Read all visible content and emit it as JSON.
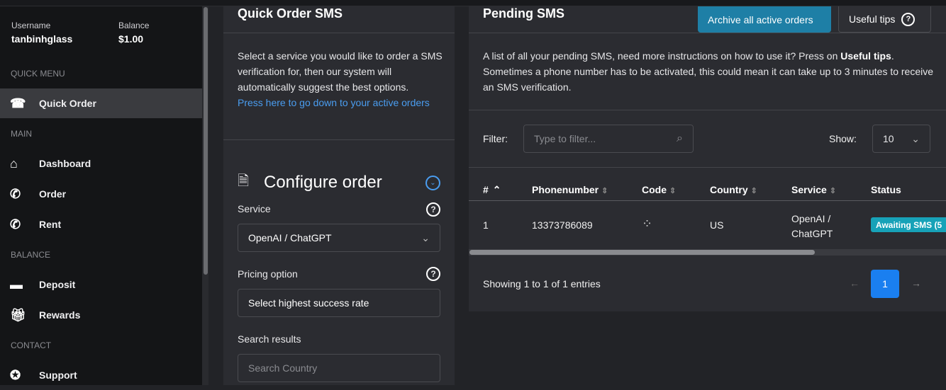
{
  "account": {
    "username_label": "Username",
    "username": "tanbinhglass",
    "balance_label": "Balance",
    "balance": "$1.00"
  },
  "sidebar": {
    "sections": [
      "Quick Menu",
      "Main",
      "Balance",
      "Contact"
    ],
    "items": [
      {
        "label": "Quick Order",
        "icon": "phone-icon"
      },
      {
        "label": "Dashboard",
        "icon": "home-icon"
      },
      {
        "label": "Order",
        "icon": "phone-plus-icon"
      },
      {
        "label": "Rent",
        "icon": "phone-add-circle-icon"
      },
      {
        "label": "Deposit",
        "icon": "credit-card-icon"
      },
      {
        "label": "Rewards",
        "icon": "gift-icon"
      },
      {
        "label": "Support",
        "icon": "lifebuoy-icon"
      }
    ]
  },
  "quick_order": {
    "title": "Quick Order SMS",
    "description": "Select a service you would like to order a SMS verification for, then our system will automatically suggest the best options.",
    "link": "Press here to go down to your active orders",
    "configure_title": "Configure order",
    "service_label": "Service",
    "service_value": "OpenAI / ChatGPT",
    "pricing_label": "Pricing option",
    "pricing_value": "Select highest success rate",
    "search_label": "Search results",
    "search_placeholder": "Search Country"
  },
  "pending": {
    "title": "Pending SMS",
    "archive_button": "Archive all active orders",
    "tips_button": "Useful tips",
    "desc_1": "A list of all your pending SMS, need more instructions on how to use it? Press on ",
    "desc_bold": "Useful tips",
    "desc_2": ". Sometimes a phone number has to be activated, this could mean it can take up to 3 minutes to receive an SMS verification.",
    "filter_label": "Filter:",
    "filter_placeholder": "Type to filter...",
    "show_label": "Show:",
    "show_value": "10",
    "columns": [
      "#",
      "Phonenumber",
      "Code",
      "Country",
      "Service",
      "Status"
    ],
    "rows": [
      {
        "num": "1",
        "phone": "13373786089",
        "country": "US",
        "service_1": "OpenAI /",
        "service_2": "ChatGPT",
        "status": "Awaiting SMS (5"
      }
    ],
    "info": "Showing 1 to 1 of 1 entries",
    "page": "1",
    "colors": {
      "accent": "#1a7ff0",
      "archive": "#1e7fa6",
      "badge": "#17a2b8"
    }
  }
}
